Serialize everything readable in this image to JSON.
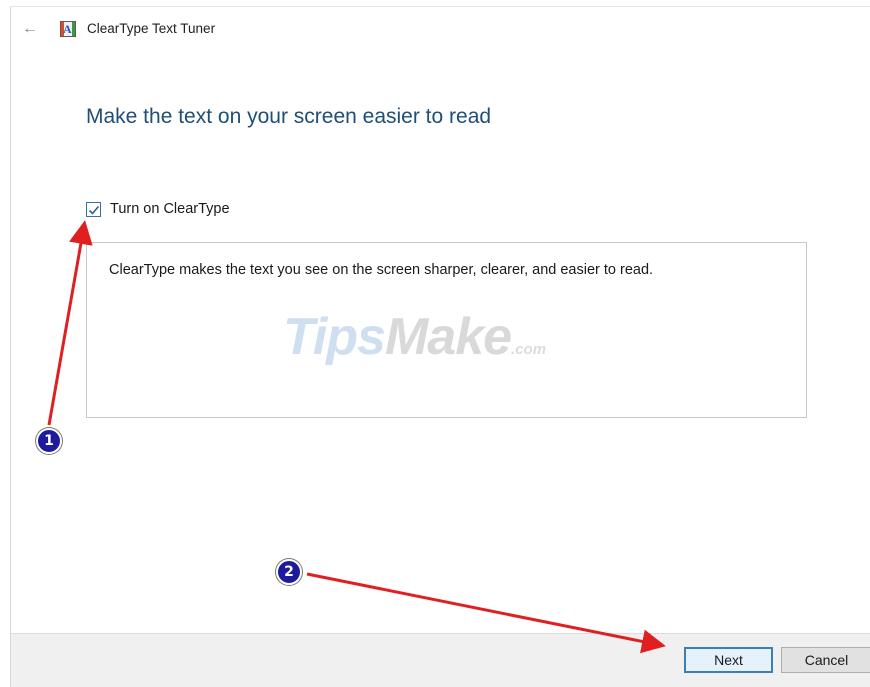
{
  "window": {
    "title": "ClearType Text Tuner",
    "back_icon": "back-arrow-icon",
    "app_icon": "cleartype-app-icon"
  },
  "content": {
    "heading": "Make the text on your screen easier to read",
    "checkbox_label": "Turn on ClearType",
    "checkbox_checked": true,
    "description": "ClearType makes the text you see on the screen sharper, clearer, and easier to read."
  },
  "watermark": {
    "part1": "Tips",
    "part2": "Make",
    "part3": ".com"
  },
  "footer": {
    "next_label": "Next",
    "cancel_label": "Cancel"
  },
  "annotations": {
    "badge1": "1",
    "badge2": "2",
    "arrow_color": "#e02020",
    "badge_color": "#1d1a9e"
  },
  "colors": {
    "heading": "#1f4e79",
    "checkbox_border": "#3a6ea5",
    "focus_border": "#3c7fb1"
  }
}
